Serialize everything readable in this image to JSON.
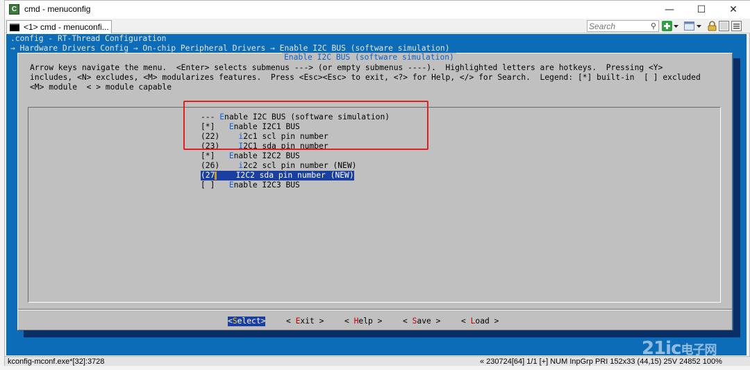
{
  "window": {
    "title": "cmd - menuconfig",
    "icon": "cmd-app-icon",
    "minimize": "—",
    "maximize": "☐",
    "close": "✕"
  },
  "tab": {
    "label": "<1> cmd - menuconfi..."
  },
  "search": {
    "placeholder": "Search"
  },
  "console": {
    "config_title": ".config - RT-Thread Configuration",
    "breadcrumbs": "→ Hardware Drivers Config → On-chip Peripheral Drivers → Enable I2C BUS (software simulation)",
    "dialog_title": "Enable I2C BUS (software simulation)",
    "help_lines": [
      "Arrow keys navigate the menu.  <Enter> selects submenus ---> (or empty submenus ----).  Highlighted letters are hotkeys.  Pressing <Y>",
      "includes, <N> excludes, <M> modularizes features.  Press <Esc><Esc> to exit, <?> for Help, </> for Search.  Legend: [*] built-in  [ ] excluded",
      "<M> module  < > module capable"
    ],
    "menu_items": [
      {
        "prefix": "--- ",
        "hot": "E",
        "rest": "nable I2C BUS (software simulation)"
      },
      {
        "prefix": "[*]   ",
        "hot": "E",
        "rest": "nable I2C1 BUS"
      },
      {
        "prefix": "(22)    ",
        "hot": "i",
        "rest": "2c1 scl pin number"
      },
      {
        "prefix": "(23)    ",
        "hot": "I",
        "rest": "2C1 sda pin number"
      },
      {
        "prefix": "[*]   ",
        "hot": "E",
        "rest": "nable I2C2 BUS"
      },
      {
        "prefix": "(26)    ",
        "hot": "i",
        "rest": "2c2 scl pin number (NEW)"
      },
      {
        "prefix": "(27",
        "hot": "",
        "rest": "    I2C2 sda pin number (NEW)"
      },
      {
        "prefix": "[ ]   ",
        "hot": "E",
        "rest": "nable I2C3 BUS"
      }
    ],
    "buttons": [
      {
        "open": "<",
        "hot": "S",
        "rest": "elect",
        "close": ">"
      },
      {
        "open": "< ",
        "hot": "E",
        "rest": "xit",
        "close": " >"
      },
      {
        "open": "< ",
        "hot": "H",
        "rest": "elp",
        "close": " >"
      },
      {
        "open": "< ",
        "hot": "S",
        "rest": "ave",
        "close": " >"
      },
      {
        "open": "< ",
        "hot": "L",
        "rest": "oad",
        "close": " >"
      }
    ]
  },
  "statusbar": {
    "left": "kconfig-mconf.exe*[32]:3728",
    "right": "« 230724[64]   1/1   [+] NUM  InpGrp   PRI    152x33   (44,15) 25V   24852  100%"
  },
  "watermark": {
    "brand": "21ic",
    "cn": "电子网"
  },
  "colors": {
    "console_bg": "#0c6cb8",
    "dialog_bg": "#c0c0c0",
    "highlight": "#1a3fa0",
    "annotation": "#e02020"
  }
}
